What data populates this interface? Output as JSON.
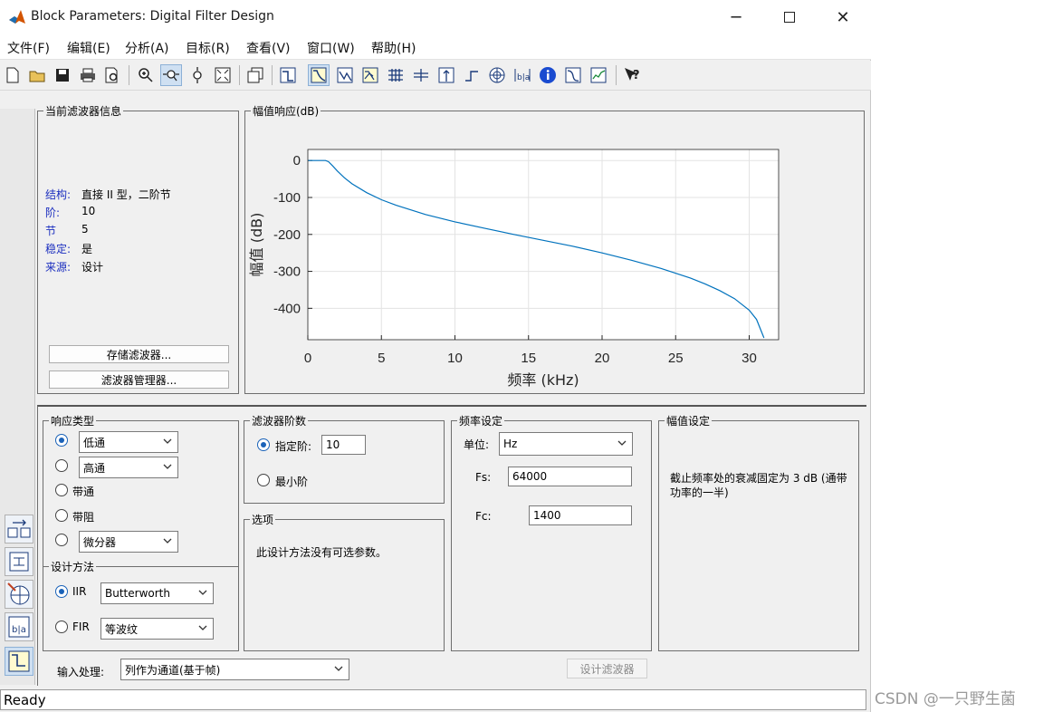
{
  "window": {
    "title": "Block Parameters: Digital Filter Design"
  },
  "menu": [
    "文件(F)",
    "编辑(E)",
    "分析(A)",
    "目标(R)",
    "查看(V)",
    "窗口(W)",
    "帮助(H)"
  ],
  "filter_info": {
    "caption": "当前滤波器信息",
    "rows": [
      {
        "key": "结构:",
        "value": "直接 II 型，二阶节"
      },
      {
        "key": "阶:",
        "value": "10"
      },
      {
        "key": "节",
        "value": "5"
      },
      {
        "key": "稳定:",
        "value": "是"
      },
      {
        "key": "来源:",
        "value": "设计"
      }
    ],
    "store_button": "存储滤波器...",
    "manager_button": "滤波器管理器..."
  },
  "chart_caption": "幅值响应(dB)",
  "chart_data": {
    "type": "line",
    "xlabel": "频率 (kHz)",
    "ylabel": "幅值 (dB)",
    "xlim": [
      0,
      32
    ],
    "ylim": [
      -485,
      30
    ],
    "xticks": [
      0,
      5,
      10,
      15,
      20,
      25,
      30
    ],
    "yticks": [
      0,
      -100,
      -200,
      -300,
      -400
    ],
    "grid": true,
    "series": [
      {
        "color": "#0072bd",
        "x": [
          0,
          1.2,
          1.4,
          1.7,
          2,
          2.5,
          3,
          4,
          5,
          6,
          8,
          10,
          12,
          14,
          16,
          18,
          20,
          22,
          24,
          26,
          27,
          28,
          29,
          30,
          30.5,
          31
        ],
        "y": [
          0,
          0,
          -3,
          -15,
          -28,
          -47,
          -63,
          -87,
          -106,
          -121,
          -146,
          -166,
          -183,
          -200,
          -216,
          -232,
          -250,
          -270,
          -292,
          -318,
          -334,
          -352,
          -374,
          -405,
          -430,
          -480
        ]
      }
    ]
  },
  "response_type": {
    "caption": "响应类型",
    "lowpass_select": "低通",
    "highpass_select": "高通",
    "bandpass_label": "带通",
    "bandstop_label": "带阻",
    "diff_select": "微分器"
  },
  "design_method": {
    "caption": "设计方法",
    "iir_label": "IIR",
    "iir_select": "Butterworth",
    "fir_label": "FIR",
    "fir_select": "等波纹"
  },
  "filter_order": {
    "caption": "滤波器阶数",
    "specify_label": "指定阶:",
    "specify_value": "10",
    "minimum_label": "最小阶"
  },
  "options": {
    "caption": "选项",
    "text": "此设计方法没有可选参数。"
  },
  "freq_spec": {
    "caption": "频率设定",
    "units_label": "单位:",
    "units_value": "Hz",
    "fs_label": "Fs:",
    "fs_value": "64000",
    "fc_label": "Fc:",
    "fc_value": "1400"
  },
  "mag_spec": {
    "caption": "幅值设定",
    "text": "截止频率处的衰减固定为 3 dB (通带功率的一半)"
  },
  "input_processing": {
    "label": "输入处理:",
    "value": "列作为通道(基于帧)"
  },
  "design_button": "设计滤波器",
  "status": "Ready",
  "watermark": "CSDN @一只野生菌"
}
